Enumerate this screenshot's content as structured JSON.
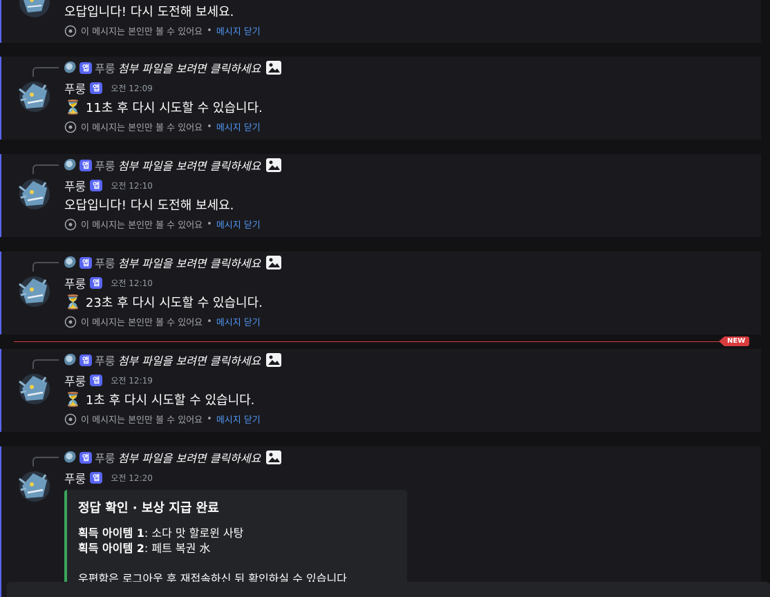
{
  "bot": {
    "name": "푸룽",
    "badge": "앱"
  },
  "reply": {
    "text": "첨부 파일을 보려면 클릭하세요"
  },
  "ephemeral": {
    "notice": "이 메시지는 본인만 볼 수 있어요",
    "separator": "•",
    "dismiss": "메시지 닫기"
  },
  "top_message": {
    "content": "오답입니다! 다시 도전해 보세요."
  },
  "messages": [
    {
      "time": "오전 12:09",
      "content": "11초 후 다시 시도할 수 있습니다."
    },
    {
      "time": "오전 12:10",
      "content": "오답입니다! 다시 도전해 보세요."
    },
    {
      "time": "오전 12:10",
      "content": "23초 후 다시 시도할 수 있습니다."
    },
    {
      "time": "오전 12:19",
      "content": "1초 후 다시 시도할 수 있습니다."
    },
    {
      "time": "오전 12:20"
    }
  ],
  "new_label": "NEW",
  "embed": {
    "title": "정답 확인 · 보상 지급 완료",
    "item1_label": "획득 아이템 1",
    "item1_value": ": 소다 맛 할로윈 사탕",
    "item2_label": "획득 아이템 2",
    "item2_value": ": 페트 복권 水",
    "footer": "우편함은 로그아웃 후 재접속하신 뒤 확인하실 수 있습니다"
  },
  "colors": {
    "accent": "#5865f2",
    "link": "#5196f4",
    "new": "#d83c3e",
    "embed_border": "#3ba55c"
  }
}
